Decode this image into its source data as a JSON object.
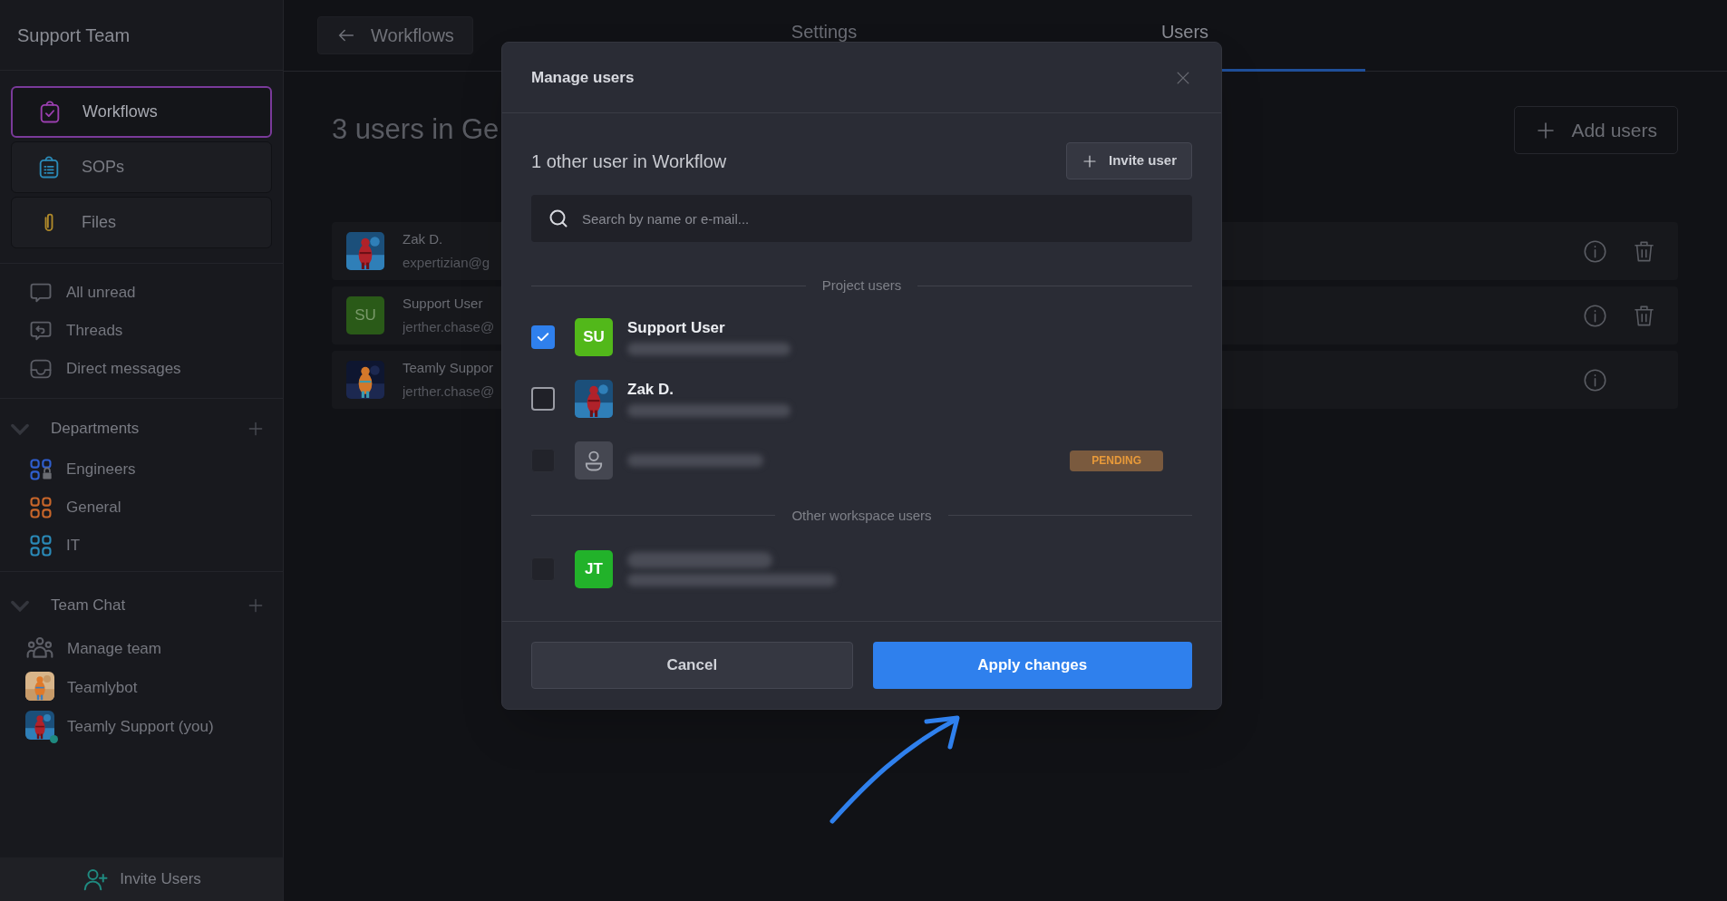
{
  "sidebar": {
    "title": "Support Team",
    "nav": [
      {
        "label": "Workflows",
        "kind": "clipboard-check",
        "selected": true
      },
      {
        "label": "SOPs",
        "kind": "clipboard-list",
        "selected": false
      },
      {
        "label": "Files",
        "kind": "paperclip",
        "selected": false
      }
    ],
    "links": [
      {
        "label": "All unread",
        "kind": "bubble"
      },
      {
        "label": "Threads",
        "kind": "reply"
      },
      {
        "label": "Direct messages",
        "kind": "inbox"
      }
    ],
    "departments": {
      "title": "Departments",
      "items": [
        {
          "label": "Engineers",
          "color": "#2f5fd0",
          "locked": true
        },
        {
          "label": "General",
          "color": "#c8662a",
          "locked": false
        },
        {
          "label": "IT",
          "color": "#2a8ab8",
          "locked": false
        }
      ]
    },
    "team_chat": {
      "title": "Team Chat",
      "items": [
        {
          "label": "Manage team",
          "kind": "team",
          "online": false
        },
        {
          "label": "Teamlybot",
          "kind": "picture",
          "online": false
        },
        {
          "label": "Teamly Support (you)",
          "kind": "picture",
          "online": true
        }
      ]
    },
    "invite": "Invite Users"
  },
  "top_bar": {
    "back": "Workflows",
    "tabs": [
      {
        "label": "Settings",
        "selected": false
      },
      {
        "label": "Users",
        "selected": true
      }
    ]
  },
  "main": {
    "heading": "3 users in Ge",
    "add_button": "Add users",
    "rows": [
      {
        "name": "Zak D.",
        "email": "expertizian@g",
        "removable": true
      },
      {
        "name": "Support User",
        "email": "jerther.chase@",
        "avatar": {
          "kind": "initials",
          "text": "SU"
        },
        "removable": true
      },
      {
        "name": "Teamly Suppor",
        "email": "jerther.chase@",
        "removable": false
      }
    ]
  },
  "modal": {
    "title": "Manage users",
    "subtitle": "1 other user in Workflow",
    "invite_button": "Invite user",
    "search": {
      "placeholder": "Search by name or e-mail..."
    },
    "groups": [
      {
        "title": "Project users",
        "users": [
          {
            "name": "Support User",
            "avatar": {
              "kind": "initials",
              "text": "SU"
            },
            "checked": true,
            "disabled": false
          },
          {
            "name": "Zak D.",
            "checked": false,
            "disabled": false
          },
          {
            "avatar": {
              "kind": "placeholder"
            },
            "checked": false,
            "disabled": true,
            "badge": "PENDING"
          }
        ]
      },
      {
        "title": "Other workspace users",
        "users": [
          {
            "avatar": {
              "kind": "initials",
              "text": "JT"
            },
            "checked": false,
            "disabled": true
          }
        ]
      }
    ],
    "cancel": "Cancel",
    "apply": "Apply changes"
  }
}
